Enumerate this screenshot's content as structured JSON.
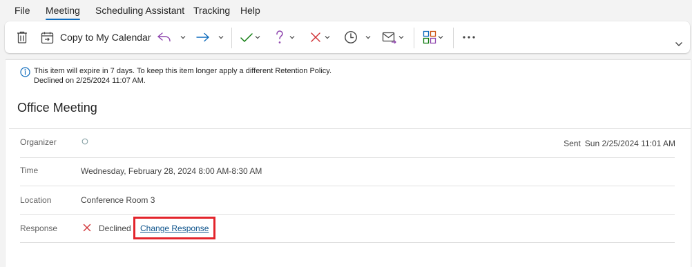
{
  "menu": {
    "tabs": [
      {
        "label": "File"
      },
      {
        "label": "Meeting"
      },
      {
        "label": "Scheduling Assistant"
      },
      {
        "label": "Tracking"
      },
      {
        "label": "Help"
      }
    ]
  },
  "ribbon": {
    "copy_label": "Copy to My Calendar",
    "icons": [
      "delete-icon",
      "copy-to-calendar-icon",
      "reply-icon",
      "forward-icon",
      "accept-icon",
      "tentative-icon",
      "decline-icon",
      "propose-time-icon",
      "respond-email-icon",
      "categorize-icon",
      "more-options-icon",
      "expand-ribbon-icon"
    ],
    "colors": {
      "reply": "#8e44ad",
      "forward": "#0f6cbd",
      "accept": "#107c10",
      "tentative": "#8e44ad",
      "decline": "#d13438"
    }
  },
  "info": {
    "line1": "This item will expire in 7 days. To keep this item longer apply a different Retention Policy.",
    "line2": "Declined on 2/25/2024 11:07 AM."
  },
  "subject": "Office Meeting",
  "details": {
    "organizer_label": "Organizer",
    "sent_label": "Sent",
    "sent_value": "Sun 2/25/2024 11:01 AM",
    "time_label": "Time",
    "time_value": "Wednesday, February 28, 2024 8:00 AM-8:30 AM",
    "location_label": "Location",
    "location_value": "Conference Room 3",
    "response_label": "Response",
    "response_value": "Declined",
    "change_response": "Change Response"
  },
  "accent_colors": {
    "tab_underline": "#0f6cbd",
    "highlight_box": "#e3242b",
    "decline": "#d13438",
    "link": "#0f548c"
  }
}
